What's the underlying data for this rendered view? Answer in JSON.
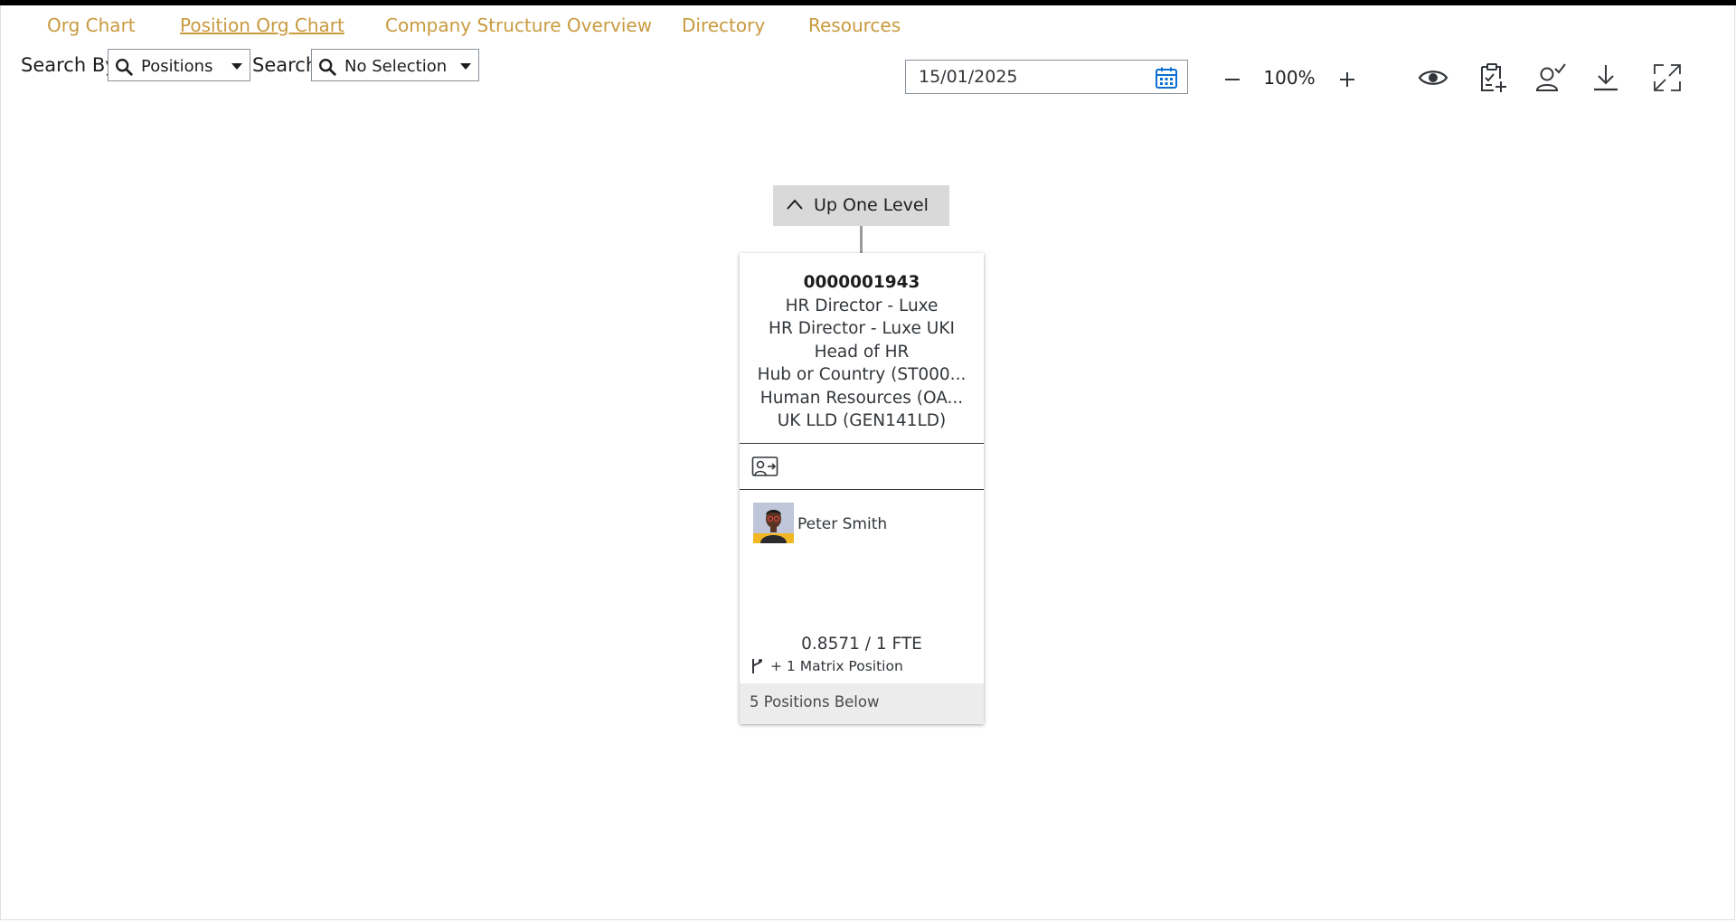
{
  "nav": {
    "tabs": [
      {
        "label": "Org Chart",
        "active": false
      },
      {
        "label": "Position Org Chart",
        "active": true
      },
      {
        "label": "Company Structure Overview",
        "active": false
      },
      {
        "label": "Directory",
        "active": false
      },
      {
        "label": "Resources",
        "active": false
      }
    ],
    "tab_color": "#c89a3e"
  },
  "search": {
    "search_by_label": "Search By",
    "search_by_value": "Positions",
    "search_label": "Search",
    "search_value": "No Selection"
  },
  "toolbar": {
    "date": "15/01/2025",
    "zoom": "100%",
    "icons": [
      "view-icon",
      "clipboard-add-icon",
      "user-check-icon",
      "download-icon",
      "fullscreen-icon"
    ]
  },
  "chart": {
    "up_level_label": "Up One Level",
    "card": {
      "position_id": "0000001943",
      "lines": [
        "HR Director - Luxe",
        "HR Director - Luxe UKI",
        "Head of HR",
        "Hub or Country (ST000...",
        "Human Resources (OA...",
        "UK LLD (GEN141LD)"
      ],
      "employee_name": "Peter Smith",
      "fte": "0.8571 / 1 FTE",
      "matrix": "+ 1 Matrix Position",
      "positions_below": "5 Positions Below"
    }
  }
}
